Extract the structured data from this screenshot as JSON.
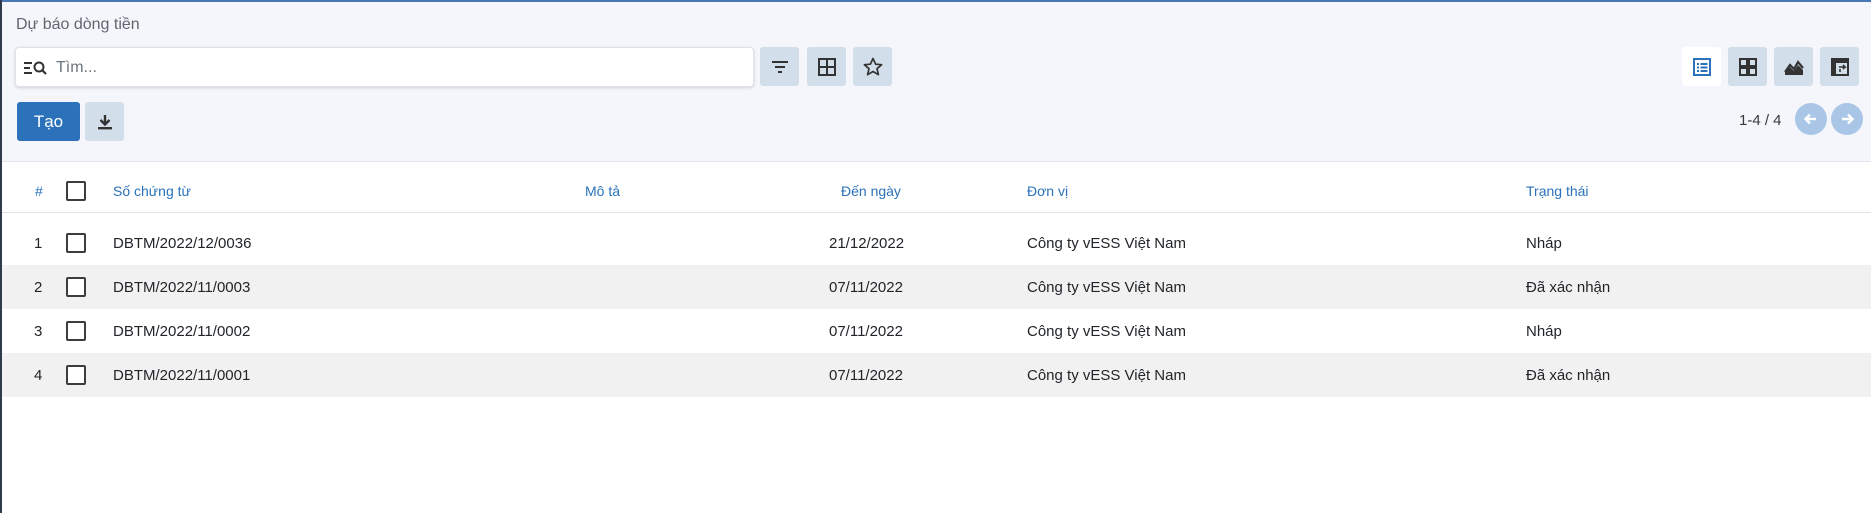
{
  "breadcrumb": "Dự báo dòng tiền",
  "search": {
    "placeholder": "Tìm..."
  },
  "toolbar": {
    "create_label": "Tạo",
    "filter_icon": "filter-icon",
    "groupby_icon": "grid-icon",
    "favorite_icon": "star-icon",
    "download_icon": "download-icon"
  },
  "views": [
    "list-view-icon",
    "kanban-view-icon",
    "graph-view-icon",
    "pivot-view-icon"
  ],
  "pager": {
    "text": "1-4 / 4"
  },
  "table": {
    "columns": {
      "num": "#",
      "doc": "Số chứng từ",
      "desc": "Mô tả",
      "date": "Đến ngày",
      "unit": "Đơn vị",
      "status": "Trạng thái"
    },
    "rows": [
      {
        "num": "1",
        "doc": "DBTM/2022/12/0036",
        "desc": "",
        "date": "21/12/2022",
        "unit": "Công ty vESS Việt Nam",
        "status": "Nháp"
      },
      {
        "num": "2",
        "doc": "DBTM/2022/11/0003",
        "desc": "",
        "date": "07/11/2022",
        "unit": "Công ty vESS Việt Nam",
        "status": "Đã xác nhận"
      },
      {
        "num": "3",
        "doc": "DBTM/2022/11/0002",
        "desc": "",
        "date": "07/11/2022",
        "unit": "Công ty vESS Việt Nam",
        "status": "Nháp"
      },
      {
        "num": "4",
        "doc": "DBTM/2022/11/0001",
        "desc": "",
        "date": "07/11/2022",
        "unit": "Công ty vESS Việt Nam",
        "status": "Đã xác nhận"
      }
    ]
  },
  "colors": {
    "accent": "#2b72ba",
    "panel": "#f4f6fb",
    "button": "#d3deeb",
    "pager_button": "#a9c6e7"
  }
}
